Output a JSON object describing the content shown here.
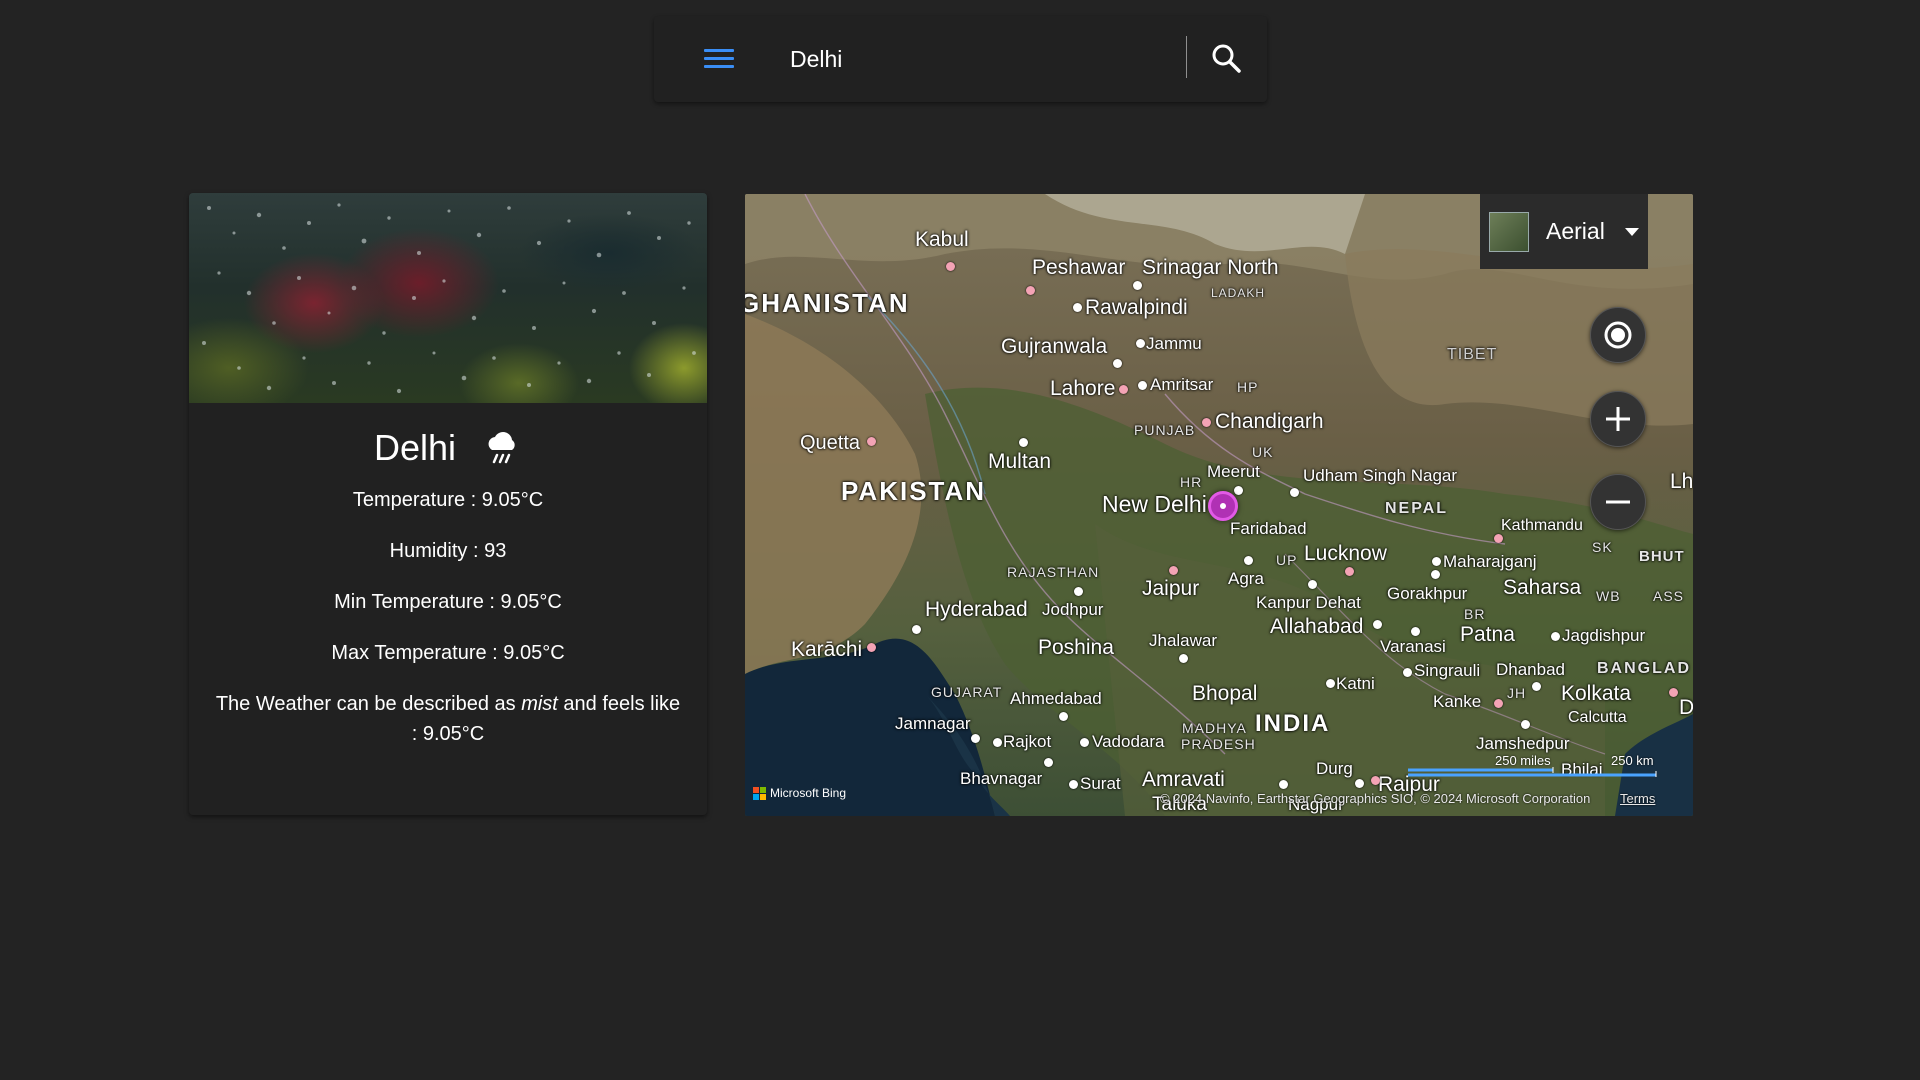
{
  "search": {
    "value": "Delhi",
    "menu_icon": "menu-icon",
    "search_icon": "search-icon",
    "accent_color": "#3a8ef6"
  },
  "card": {
    "city": "Delhi",
    "weather_icon": "rain-cloud-icon",
    "temperature": "Temperature : 9.05°C",
    "humidity": "Humidity : 93",
    "min_temperature": "Min Temperature : 9.05°C",
    "max_temperature": "Max Temperature : 9.05°C",
    "description_prefix": "The Weather can be described as ",
    "description_condition": "mist",
    "description_suffix": " and feels like : 9.05°C"
  },
  "map": {
    "map_type": "Aerial",
    "controls": [
      "locate-me-icon",
      "zoom-in-icon",
      "zoom-out-icon"
    ],
    "labels": {
      "kabul": "Kabul",
      "peshawar": "Peshawar",
      "srinagar_north": "Srinagar North",
      "rawalpindi": "Rawalpindi",
      "ghanistan": "GHANISTAN",
      "ladakh": "LADAKH",
      "gujranwala": "Gujranwala",
      "jammu": "Jammu",
      "tibet": "TIBET",
      "lahore": "Lahore",
      "amritsar": "Amritsar",
      "hp": "HP",
      "quetta": "Quetta",
      "punjab": "PUNJAB",
      "chandigarh": "Chandigarh",
      "multan": "Multan",
      "uk": "UK",
      "pakistan": "PAKISTAN",
      "hr": "HR",
      "meerut": "Meerut",
      "udham_singh_nagar": "Udham Singh Nagar",
      "lh": "Lh",
      "new_delhi": "New Delhi",
      "nepal": "NEPAL",
      "faridabad": "Faridabad",
      "kathmandu": "Kathmandu",
      "sk": "SK",
      "bhut": "BHUT",
      "rajasthan": "RAJASTHAN",
      "up": "UP",
      "lucknow": "Lucknow",
      "maharajganj": "Maharajganj",
      "agra": "Agra",
      "jaipur": "Jaipur",
      "kanpur_dehat": "Kanpur Dehat",
      "gorakhpur": "Gorakhpur",
      "saharsa": "Saharsa",
      "wb": "WB",
      "ass": "ASS",
      "hyderabad": "Hyderabad",
      "jodhpur": "Jodhpur",
      "br": "BR",
      "allahabad": "Allahabad",
      "patna": "Patna",
      "jagdishpur": "Jagdishpur",
      "karachi": "Karāchi",
      "poshina": "Poshina",
      "jhalawar": "Jhalawar",
      "varanasi": "Varanasi",
      "dhanbad": "Dhanbad",
      "bangladesh": "BANGLAD",
      "singrauli": "Singrauli",
      "katni": "Katni",
      "gujarat": "GUJARAT",
      "ahmedabad": "Ahmedabad",
      "bhopal": "Bhopal",
      "kanke": "Kanke",
      "jh": "JH",
      "kolkata": "Kolkata",
      "calcutta": "Calcutta",
      "d": "D",
      "jamnagar": "Jamnagar",
      "madhya": "MADHYA",
      "pradesh": "PRADESH",
      "india": "INDIA",
      "rajkot": "Rajkot",
      "vadodara": "Vadodara",
      "jamshedpur": "Jamshedpur",
      "durg": "Durg",
      "raipur": "Raipur",
      "bhavnagar": "Bhavnagar",
      "surat": "Surat",
      "amravati": "Amravati",
      "nagpur": "Nagpur",
      "taluka": "Taluka",
      "bhilai": "Bhilai"
    },
    "scale_miles": "250 miles",
    "scale_km": "250 km",
    "attribution_logo": "Microsoft Bing",
    "copyright": "© 2024 Navinfo, Earthstar Geographics SIO, © 2024 Microsoft Corporation",
    "terms": "Terms"
  }
}
